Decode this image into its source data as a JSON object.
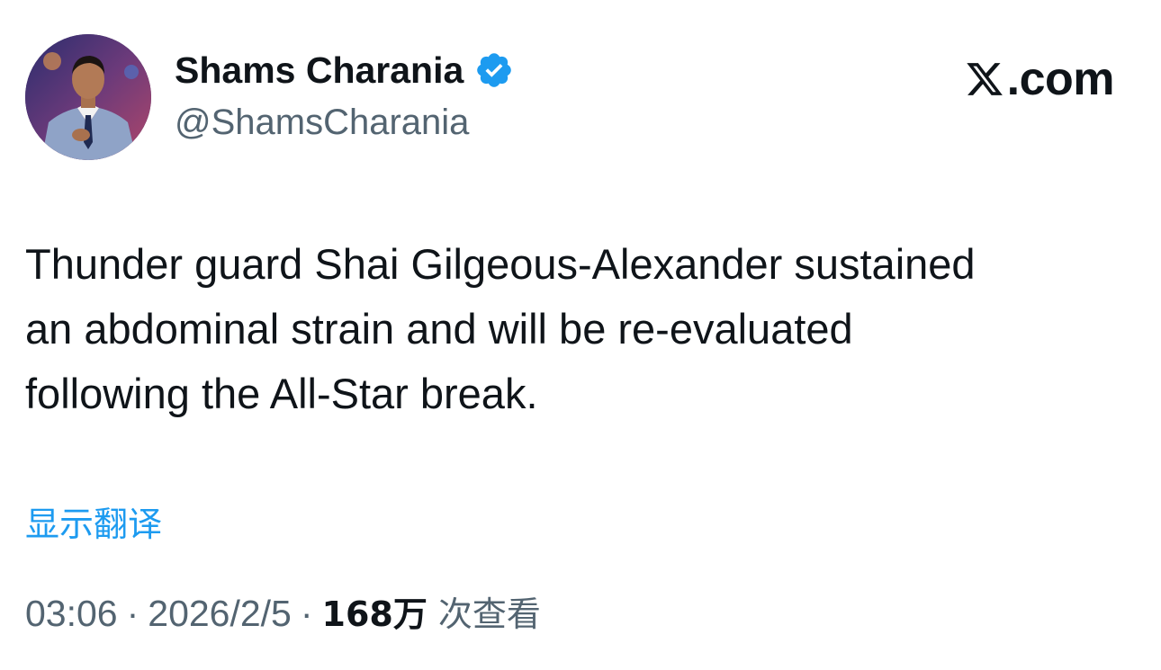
{
  "author": {
    "display_name": "Shams Charania",
    "handle": "@ShamsCharania",
    "verified": true
  },
  "brand": {
    "text": ".com",
    "logo_icon": "x-logo-icon"
  },
  "tweet": {
    "text": "Thunder guard Shai Gilgeous-Alexander sustained\nan abdominal strain and will be re-evaluated\nfollowing the All-Star break.",
    "translate_label": "显示翻译"
  },
  "meta": {
    "time": "03:06",
    "separator": "·",
    "date": "2026/2/5",
    "views_count": "168万",
    "views_label": "次查看"
  },
  "colors": {
    "text_primary": "#0f1419",
    "text_secondary": "#536471",
    "accent": "#1d9bf0"
  }
}
